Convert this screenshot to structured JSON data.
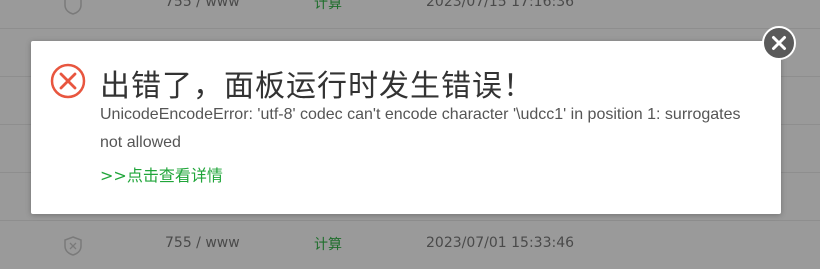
{
  "background_rows": [
    {
      "permission": "755 / www",
      "action": "计算",
      "time": "2023/07/15 17:16:36"
    },
    {
      "permission": "",
      "action": "",
      "time": ""
    },
    {
      "permission": "",
      "action": "",
      "time": ""
    },
    {
      "permission": "",
      "action": "",
      "time": ""
    },
    {
      "permission": "755 / www",
      "action": "计算",
      "time": "2023/07/01 15:33:46"
    }
  ],
  "dialog": {
    "title": "出错了，面板运行时发生错误！",
    "message": "UnicodeEncodeError: 'utf-8' codec can't encode character '\\udcc1' in position 1: surrogates not allowed",
    "details_link": ">>点击查看详情"
  },
  "colors": {
    "error_red": "#e8563f",
    "link_green": "#20a53a",
    "close_bg": "#5a5a5a"
  },
  "icons": {
    "error": "error-circle-x-icon",
    "close": "close-icon",
    "shield": "shield-icon"
  }
}
